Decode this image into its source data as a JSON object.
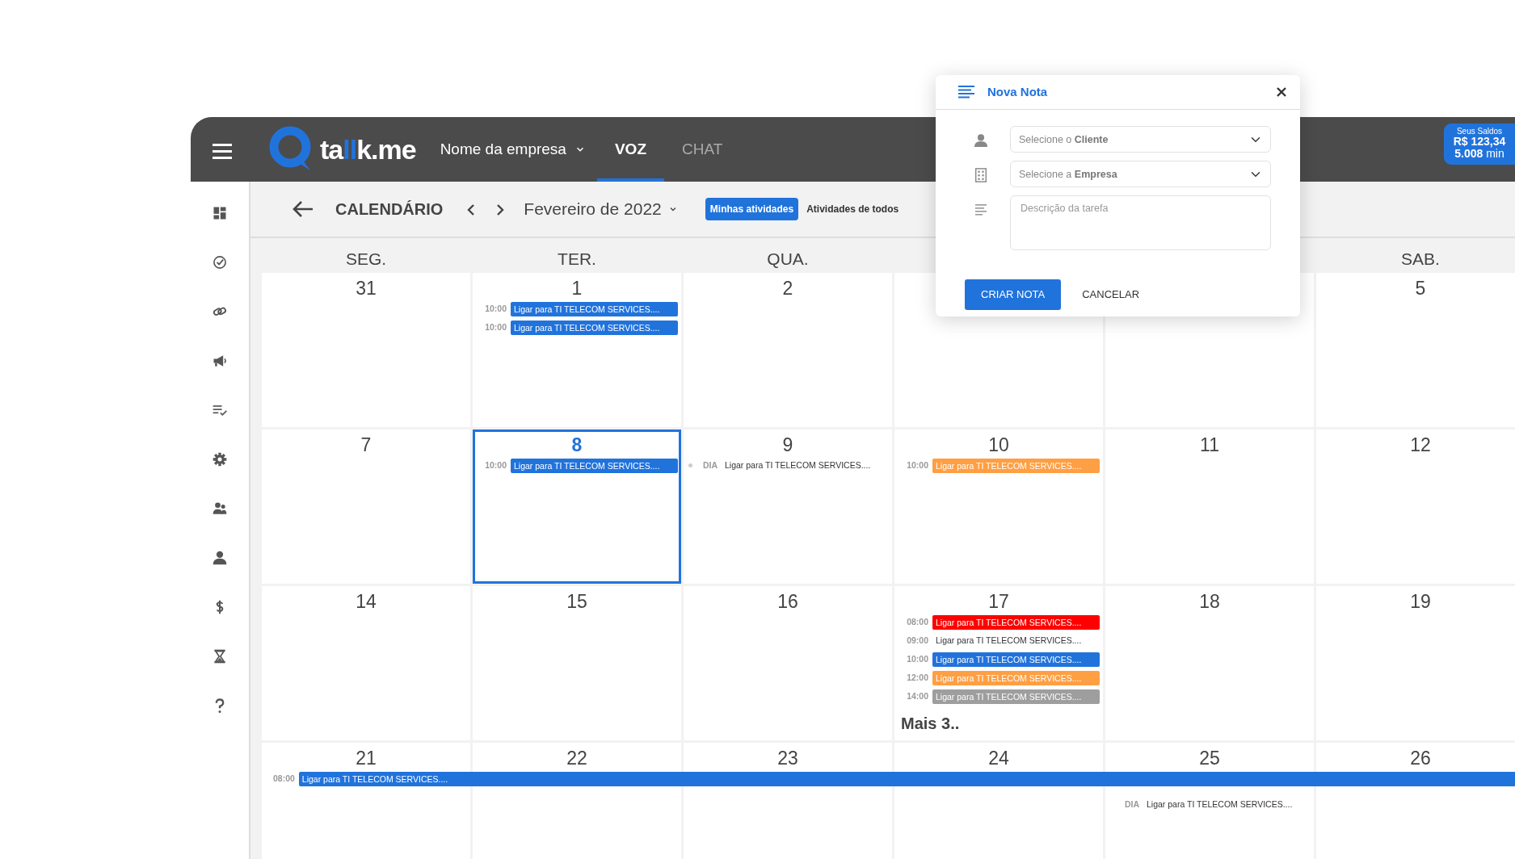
{
  "header": {
    "logo": [
      {
        "text": "ta",
        "accent": false
      },
      {
        "text": "ll",
        "accent": true
      },
      {
        "text": "k.me",
        "accent": false
      }
    ],
    "company": "Nome da empresa",
    "tabs": [
      {
        "label": "VOZ",
        "selected": true
      },
      {
        "label": "CHAT",
        "selected": false
      }
    ],
    "balance": {
      "title": "Seus Saldos",
      "money": "R$ 123,34",
      "minutes": "**5.008** min"
    }
  },
  "toolbar": {
    "title": "CALENDÁRIO",
    "month": "Fevereiro de 2022",
    "filters": [
      {
        "label": "Minhas atividades",
        "selected": true
      },
      {
        "label": "Atividades de todos",
        "selected": false
      }
    ]
  },
  "weekdays": [
    {
      "label": "SEG."
    },
    {
      "label": "TER."
    },
    {
      "label": "QUA."
    },
    {
      "covered": true
    },
    {
      "covered": true
    },
    {
      "label": "SAB."
    }
  ],
  "weeks": [
    {
      "days": [
        {
          "date": "31",
          "selected": false
        },
        {
          "date": "1",
          "selected": false,
          "events": [
            {
              "time": "10:00",
              "title": "Ligar para TI TELECOM SERVICES....",
              "color": "#2173dc"
            },
            {
              "time": "10:00",
              "title": "Ligar para TI TELECOM SERVICES....",
              "color": "#2173dc"
            }
          ]
        },
        {
          "date": "2",
          "selected": false
        },
        {
          "covered": true
        },
        {
          "covered": true
        },
        {
          "date": "5",
          "selected": false
        }
      ]
    },
    {
      "days": [
        {
          "date": "7",
          "selected": false
        },
        {
          "date": "8",
          "selected": true,
          "events": [
            {
              "time": "10:00",
              "title": "Ligar para TI TELECOM SERVICES....",
              "color": "#2173dc"
            }
          ]
        },
        {
          "date": "9",
          "selected": false,
          "events": [
            {
              "time": "DIA",
              "title": "Ligar para TI TELECOM SERVICES....",
              "dot": true
            }
          ]
        },
        {
          "date": "10",
          "selected": false,
          "events": [
            {
              "time": "10:00",
              "title": "Ligar para TI TELECOM SERVICES....",
              "color": "#ff9f43"
            }
          ]
        },
        {
          "date": "11",
          "selected": false
        },
        {
          "date": "12",
          "selected": false
        }
      ]
    },
    {
      "days": [
        {
          "date": "14",
          "selected": false
        },
        {
          "date": "15",
          "selected": false
        },
        {
          "date": "16",
          "selected": false
        },
        {
          "date": "17",
          "selected": false,
          "events": [
            {
              "time": "08:00",
              "title": "Ligar para TI TELECOM SERVICES....",
              "color": "#ff0000"
            },
            {
              "time": "09:00",
              "title": "Ligar para TI TELECOM SERVICES...."
            },
            {
              "time": "10:00",
              "title": "Ligar para TI TELECOM SERVICES....",
              "color": "#2173dc"
            },
            {
              "time": "12:00",
              "title": "Ligar para TI TELECOM SERVICES....",
              "color": "#ff9f43"
            },
            {
              "time": "14:00",
              "title": "Ligar para TI TELECOM SERVICES....",
              "color": "#9e9e9e"
            }
          ],
          "more": "Mais 3.."
        },
        {
          "date": "18",
          "selected": false
        },
        {
          "date": "19",
          "selected": false
        }
      ]
    },
    {
      "days": [
        {
          "date": "21",
          "selected": false,
          "spanning_event": {
            "time": "08:00",
            "title": "Ligar para TI TELECOM SERVICES....",
            "color": "#2173dc"
          }
        },
        {
          "date": "22",
          "selected": false
        },
        {
          "date": "23",
          "selected": false
        },
        {
          "date": "24",
          "selected": false
        },
        {
          "date": "25",
          "selected": false,
          "events": [
            {
              "time": "DIA",
              "title": "Ligar para TI TELECOM SERVICES...."
            }
          ]
        },
        {
          "date": "26",
          "selected": false
        }
      ]
    }
  ],
  "modal": {
    "title": "Nova Nota",
    "fields": [
      {
        "kind": "select",
        "placeholder": "Selecione o **Cliente**"
      },
      {
        "kind": "select",
        "placeholder": "Selecione a **Empresa**"
      },
      {
        "kind": "textarea",
        "placeholder": "Descrição da tarefa"
      }
    ],
    "buttons": [
      {
        "kind": "primary",
        "label": "CRIAR NOTA"
      },
      {
        "kind": "text",
        "label": "CANCELAR"
      }
    ]
  }
}
